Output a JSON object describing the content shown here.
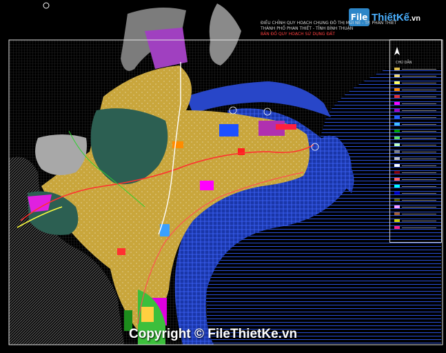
{
  "logo": {
    "badge": "File",
    "name": "ThiếtKế",
    "domain": ".vn"
  },
  "title_lines": [
    "ĐIỀU CHỈNH QUY HOẠCH CHUNG ĐÔ THỊ MŨI NÉ - TP. PHAN THIẾT",
    "THÀNH PHỐ PHAN THIẾT - TỈNH BÌNH THUẬN",
    "BẢN ĐỒ QUY HOẠCH SỬ DỤNG ĐẤT"
  ],
  "legend": {
    "title": "CHÚ DẪN",
    "swatches": [
      "#e0c050",
      "#f0d878",
      "#ffff60",
      "#ff8c00",
      "#e03030",
      "#ff00ff",
      "#a000c0",
      "#2060ff",
      "#40c0ff",
      "#00a000",
      "#60e060",
      "#c0ffc0",
      "#808080",
      "#c0c0c0",
      "#ffffff",
      "#800000",
      "#ff6060",
      "#00ffff",
      "#0000c0",
      "#606000",
      "#ffa0ff",
      "#a06030",
      "#d0d000",
      "#ff2080"
    ]
  },
  "copyright": "Copyright © FileThietKe.vn",
  "colors": {
    "background": "#000000",
    "sea": "#2a4fd8",
    "residential": "#d9b84a",
    "greenery": "#2c5f52",
    "water_body": "#3a6e5f",
    "road": "#ff3030",
    "frame": "#e6e6e6"
  }
}
